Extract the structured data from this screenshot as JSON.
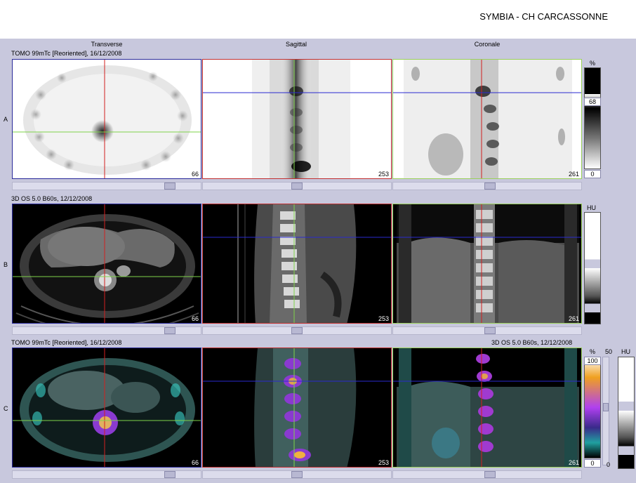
{
  "header": {
    "site": "SYMBIA - CH CARCASSONNE"
  },
  "columns": {
    "transverse": "Transverse",
    "sagittal": "Sagittal",
    "coronal": "Coronale"
  },
  "rows": {
    "a": {
      "letter": "A",
      "info": "TOMO 99mTc [Reoriented], 16/12/2008"
    },
    "b": {
      "letter": "B",
      "info": "3D  OS  5.0  B60s, 12/12/2008"
    },
    "c": {
      "letter": "C",
      "info_left": "TOMO 99mTc [Reoriented], 16/12/2008",
      "info_right": "3D  OS  5.0  B60s, 12/12/2008"
    }
  },
  "slices": {
    "transverse": "66",
    "sagittal": "253",
    "coronal": "261"
  },
  "colorbars": {
    "a": {
      "unit": "%",
      "high": "68",
      "low": "0"
    },
    "b": {
      "unit": "HU"
    },
    "c": {
      "unit": "%",
      "high": "100",
      "low": "0",
      "mid": "50",
      "mid_low": "0",
      "unit2": "HU"
    }
  },
  "colors": {
    "crosshair_red": "#d22020",
    "crosshair_green": "#7ed34a",
    "crosshair_blue": "#2a2ad0",
    "frame_transverse": "#2a2a9a",
    "frame_sagittal": "#c23030",
    "frame_coronal": "#9ad05a"
  }
}
